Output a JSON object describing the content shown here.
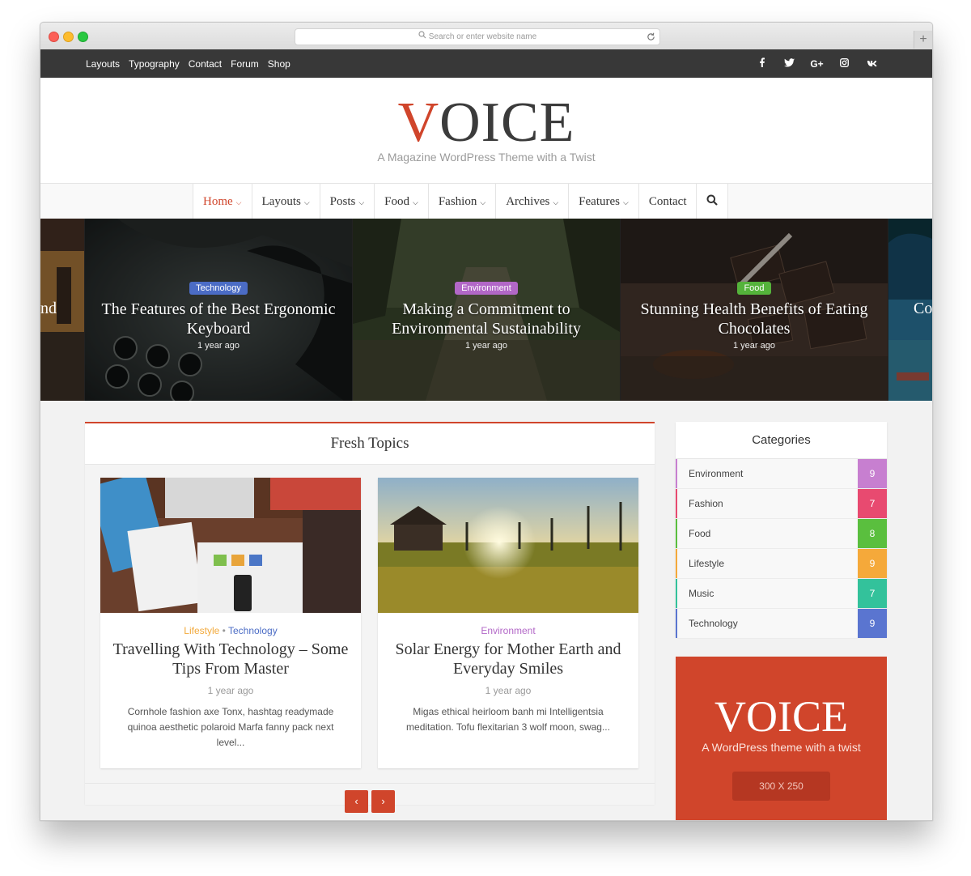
{
  "browser": {
    "url_placeholder": "Search or enter website name",
    "new_tab": "+"
  },
  "topbar": {
    "links": [
      "Layouts",
      "Typography",
      "Contact",
      "Forum",
      "Shop"
    ],
    "social": [
      "f",
      "t",
      "G+",
      "ig",
      "vk"
    ]
  },
  "header": {
    "logo_v": "V",
    "logo_rest": "OICE",
    "tagline": "A Magazine WordPress Theme with a Twist"
  },
  "nav": {
    "items": [
      {
        "label": "Home",
        "has_caret": true
      },
      {
        "label": "Layouts",
        "has_caret": true
      },
      {
        "label": "Posts",
        "has_caret": true
      },
      {
        "label": "Food",
        "has_caret": true
      },
      {
        "label": "Fashion",
        "has_caret": true
      },
      {
        "label": "Archives",
        "has_caret": true
      },
      {
        "label": "Features",
        "has_caret": true
      },
      {
        "label": "Contact",
        "has_caret": false
      }
    ],
    "caret": "⌵",
    "active_color": "#d0452b"
  },
  "slider": {
    "left_edge_text": "nd",
    "right_edge_text": "Co",
    "slides": [
      {
        "badge": "Technology",
        "badge_color": "#4b6cc5",
        "title": "The Features of the Best Ergonomic Keyboard",
        "time": "1 year ago"
      },
      {
        "badge": "Environment",
        "badge_color": "#b267c7",
        "title": "Making a Commitment to Environmental Sustainability",
        "time": "1 year ago"
      },
      {
        "badge": "Food",
        "badge_color": "#54b33b",
        "title": "Stunning Health Benefits of Eating Chocolates",
        "time": "1 year ago"
      }
    ]
  },
  "fresh": {
    "heading": "Fresh Topics",
    "cards": [
      {
        "cat1": "Lifestyle",
        "cat1_color": "#f2a93b",
        "sep": " • ",
        "cat2": "Technology",
        "cat2_color": "#4b6cc5",
        "title": "Travelling With Technology – Some Tips From Master",
        "time": "1 year ago",
        "excerpt": "Cornhole fashion axe Tonx, hashtag readymade quinoa aesthetic polaroid Marfa fanny pack next level..."
      },
      {
        "cat1": "Environment",
        "cat1_color": "#b267c7",
        "sep": "",
        "cat2": "",
        "cat2_color": "",
        "title": "Solar Energy for Mother Earth and Everyday Smiles",
        "time": "1 year ago",
        "excerpt": "Migas ethical heirloom banh mi Intelligentsia meditation. Tofu flexitarian 3 wolf moon, swag..."
      }
    ],
    "prev": "‹",
    "next": "›"
  },
  "categories": {
    "heading": "Categories",
    "items": [
      {
        "label": "Environment",
        "count": "9",
        "color": "#c77fd0"
      },
      {
        "label": "Fashion",
        "count": "7",
        "color": "#e84a70"
      },
      {
        "label": "Food",
        "count": "8",
        "color": "#5abf3e"
      },
      {
        "label": "Lifestyle",
        "count": "9",
        "color": "#f5a93a"
      },
      {
        "label": "Music",
        "count": "7",
        "color": "#33c29b"
      },
      {
        "label": "Technology",
        "count": "9",
        "color": "#5a75d0"
      }
    ]
  },
  "ad": {
    "title": "VOICE",
    "subtitle": "A WordPress theme with a twist",
    "size": "300 X 250"
  },
  "accent": "#d0452b"
}
